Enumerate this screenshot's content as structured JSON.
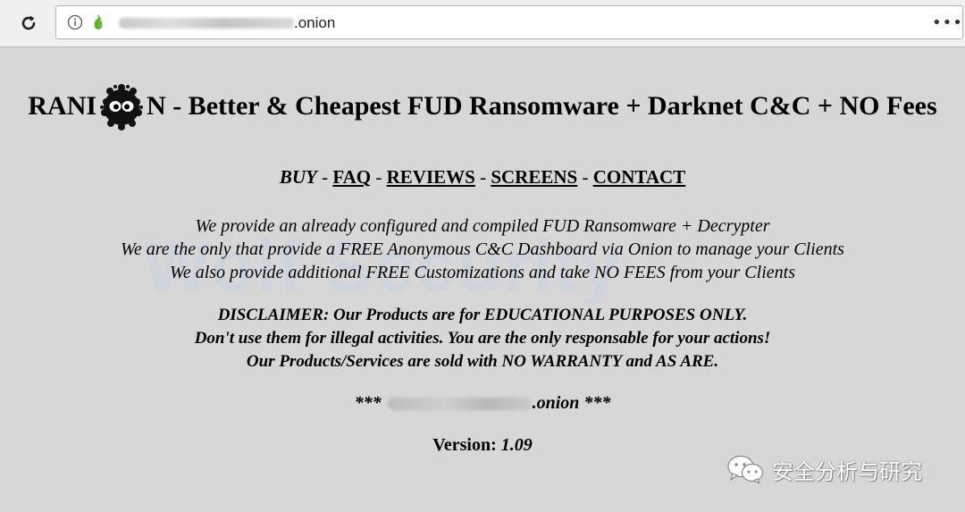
{
  "browser": {
    "url_suffix": ".onion",
    "menu_label": "•••"
  },
  "page": {
    "title_left": "RANI",
    "title_right": "N - Better & Cheapest FUD Ransomware + Darknet C&C + NO Fees",
    "nav": {
      "buy": "BUY",
      "separator": " - ",
      "faq": "FAQ",
      "reviews": "REVIEWS",
      "screens": "SCREENS",
      "contact": "CONTACT"
    },
    "description": [
      "We provide an already configured and compiled FUD Ransomware + Decrypter",
      "We are the only that provide a FREE Anonymous C&C Dashboard via Onion to manage your Clients",
      "We also provide additional FREE Customizations and take NO FEES from your Clients"
    ],
    "disclaimer": [
      "DISCLAIMER: Our Products are for EDUCATIONAL PURPOSES ONLY.",
      "Don't use them for illegal activities. You are the only responsable for your actions!",
      "Our Products/Services are sold with NO WARRANTY and AS ARE."
    ],
    "onion_prefix": "*** ",
    "onion_suffix": ".onion ***",
    "version_label": "Version: ",
    "version_number": "1.09"
  },
  "overlay": {
    "watermark_bg": "Wolf Security",
    "brand_text": "安全分析与研究"
  },
  "icons": {
    "reload": "reload-icon",
    "info": "info-icon",
    "onion": "onion-icon",
    "mascot": "soot-sprite-icon",
    "brand": "wechat-icon"
  }
}
